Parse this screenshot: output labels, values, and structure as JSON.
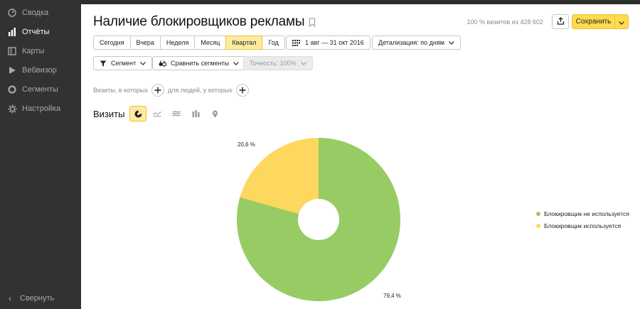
{
  "sidebar": {
    "items": [
      {
        "label": "Сводка",
        "icon": "dashboard-icon",
        "active": false
      },
      {
        "label": "Отчёты",
        "icon": "bar-chart-icon",
        "active": true
      },
      {
        "label": "Карты",
        "icon": "map-icon",
        "active": false
      },
      {
        "label": "Вебвизор",
        "icon": "play-icon",
        "active": false
      },
      {
        "label": "Сегменты",
        "icon": "segments-icon",
        "active": false
      },
      {
        "label": "Настройка",
        "icon": "gear-icon",
        "active": false
      }
    ],
    "collapse_label": "Свернуть"
  },
  "header": {
    "title": "Наличие блокировщиков рекламы",
    "visits_info": "100 % визитов из 428 602",
    "save_label": "Сохранить"
  },
  "toolbar": {
    "periods": [
      "Сегодня",
      "Вчера",
      "Неделя",
      "Месяц",
      "Квартал",
      "Год"
    ],
    "active_period": "Квартал",
    "date_range": "1 авг — 31 окт 2016",
    "detail": "Детализация: по дням",
    "segment": "Сегмент",
    "compare": "Сравнить сегменты",
    "accuracy": "Точность: 100%"
  },
  "conditions": {
    "visits_which": "Визиты, в которых",
    "people_which": "для людей, у которых"
  },
  "report": {
    "metric_label": "Визиты"
  },
  "colors": {
    "accent": "#ffdb4d",
    "green": "#97cc64",
    "yellow": "#fed75f"
  },
  "chart_data": {
    "type": "pie",
    "donut": true,
    "slices": [
      {
        "name": "Блокировщик не используется",
        "value": 79.4,
        "label": "79,4 %",
        "color": "#97cc64"
      },
      {
        "name": "Блокировщик используется",
        "value": 20.6,
        "label": "20,6 %",
        "color": "#fed75f"
      }
    ],
    "legend_position": "right"
  }
}
